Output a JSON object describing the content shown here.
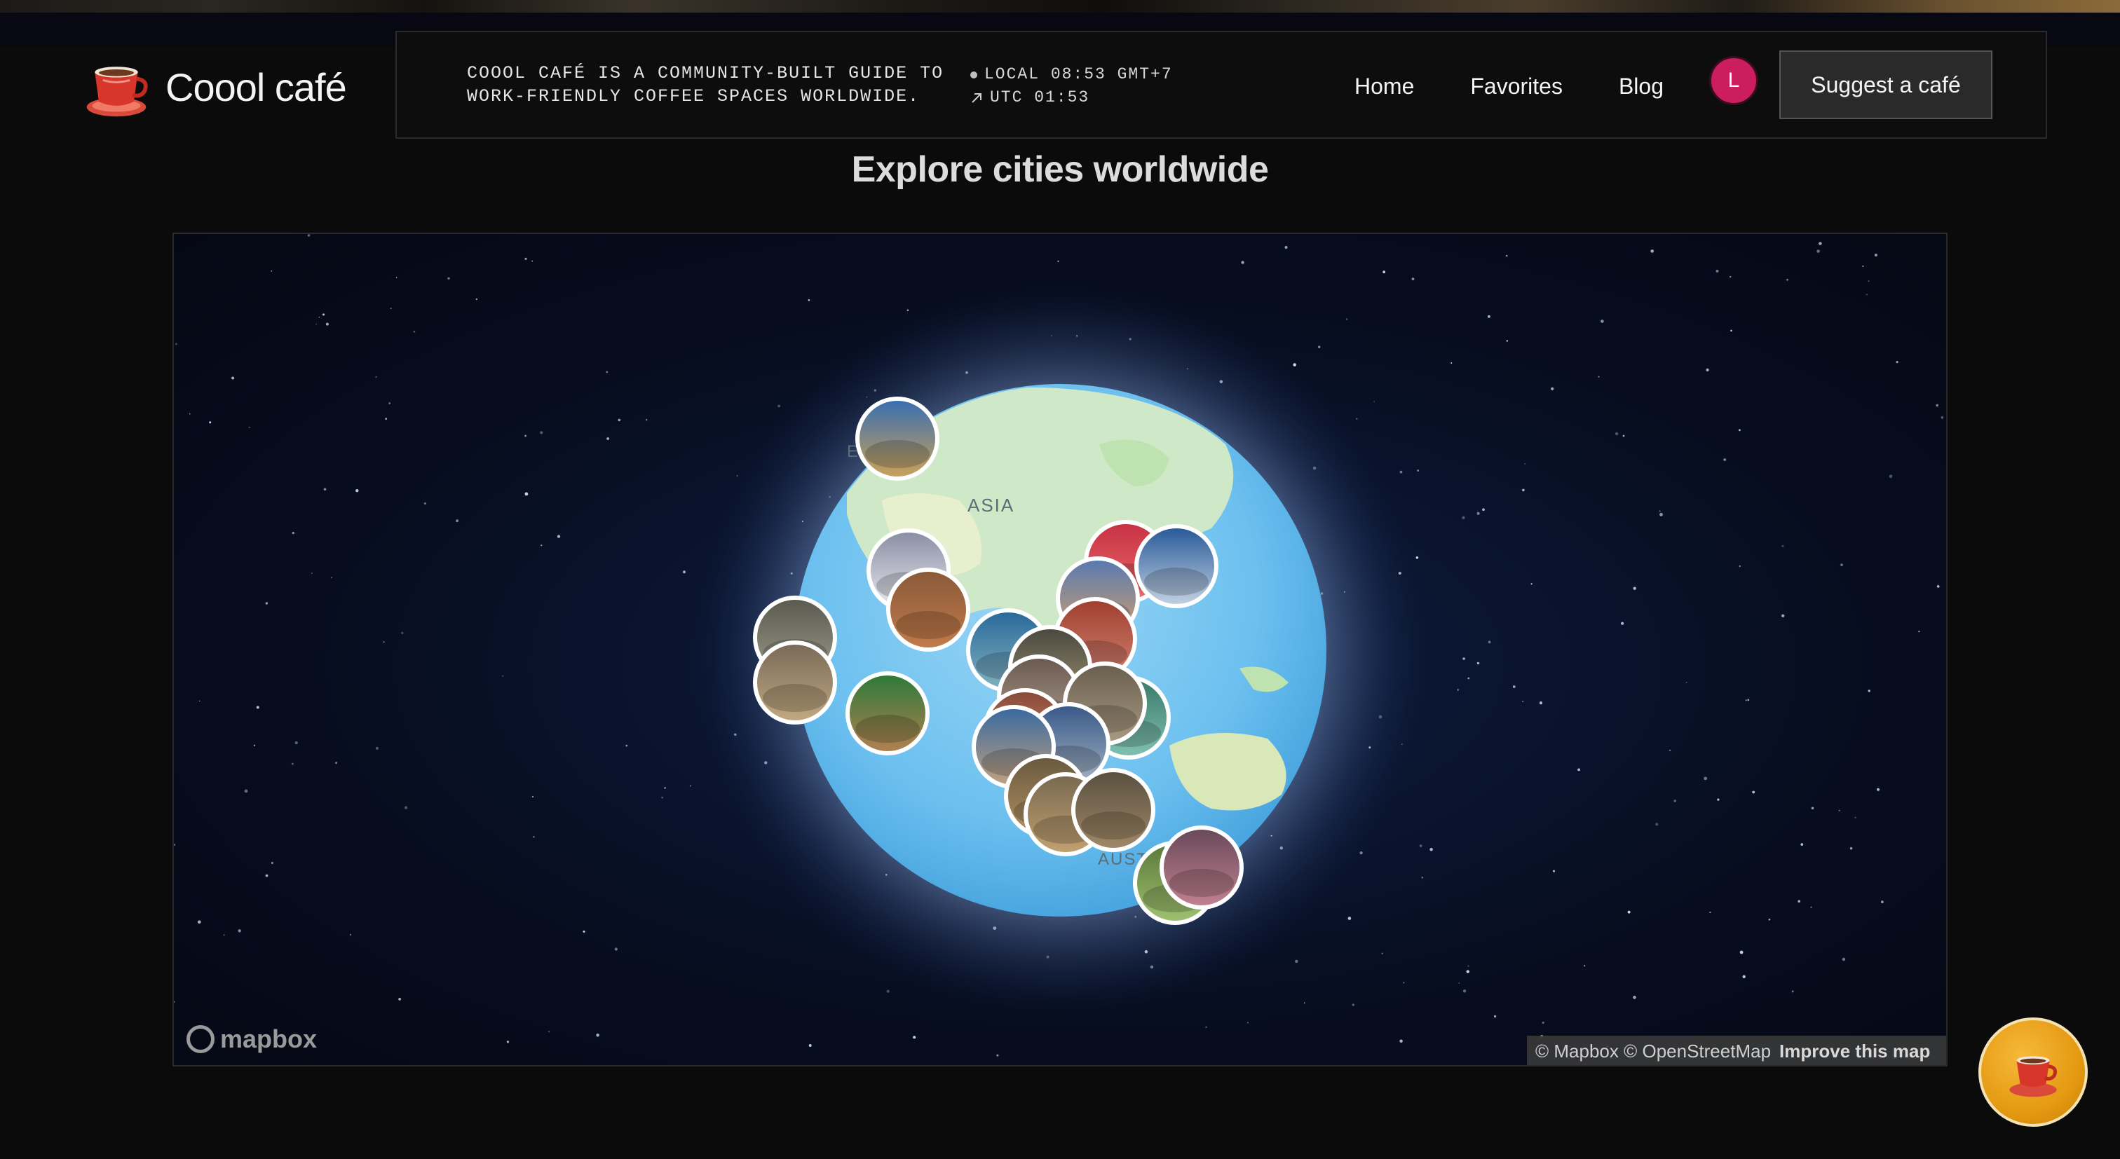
{
  "brand": {
    "name": "Coool café",
    "icon": "coffee-cup-icon"
  },
  "header": {
    "tagline": "COOOL CAFÉ IS A COMMUNITY-BUILT GUIDE TO\nWORK-FRIENDLY COFFEE SPACES WORLDWIDE.",
    "local_time": "LOCAL 08:53 GMT+7",
    "utc_time": "UTC 01:53"
  },
  "nav": {
    "home": "Home",
    "favorites": "Favorites",
    "blog": "Blog"
  },
  "user": {
    "avatar_initial": "L",
    "avatar_color": "#cc1e5e"
  },
  "actions": {
    "suggest_label": "Suggest a café"
  },
  "main": {
    "title": "Explore cities worldwide"
  },
  "map": {
    "labels": {
      "asia": "ASIA",
      "australia": "AUST",
      "europe_partial": "E"
    },
    "provider_logo": "mapbox",
    "attribution": "© Mapbox © OpenStreetMap",
    "improve_link": "Improve this map"
  },
  "colors": {
    "accent": "#cc1e5e",
    "fab": "#e59a12",
    "background": "#0b0b0b"
  }
}
